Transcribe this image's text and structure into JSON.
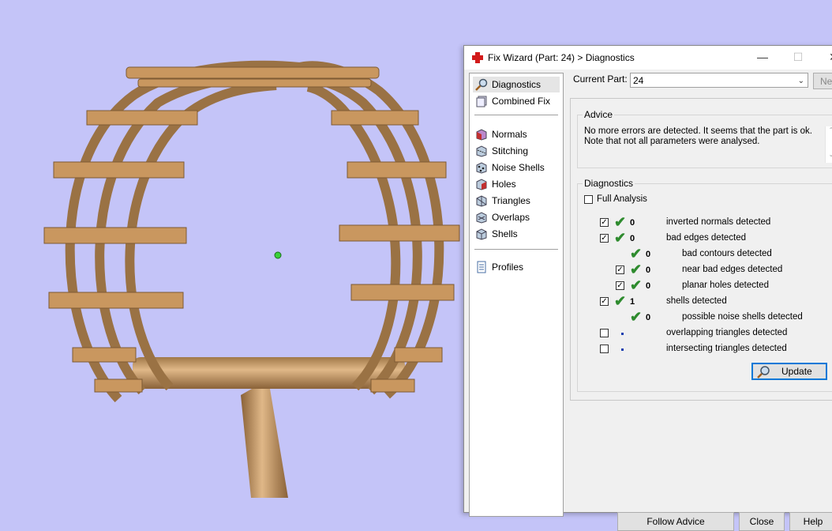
{
  "window": {
    "title": "Fix Wizard (Part: 24) > Diagnostics",
    "minimize": "—",
    "maximize": "☐",
    "close": "✕"
  },
  "sidebar": {
    "items": [
      {
        "label": "Diagnostics",
        "icon": "magnifier-icon"
      },
      {
        "label": "Combined Fix",
        "icon": "combined-fix-icon"
      },
      {
        "label": "Normals",
        "icon": "normals-icon"
      },
      {
        "label": "Stitching",
        "icon": "stitching-icon"
      },
      {
        "label": "Noise Shells",
        "icon": "noise-shells-icon"
      },
      {
        "label": "Holes",
        "icon": "holes-icon"
      },
      {
        "label": "Triangles",
        "icon": "triangles-icon"
      },
      {
        "label": "Overlaps",
        "icon": "overlaps-icon"
      },
      {
        "label": "Shells",
        "icon": "shells-icon"
      },
      {
        "label": "Profiles",
        "icon": "profiles-icon"
      }
    ]
  },
  "current_part": {
    "label": "Current Part:",
    "value": "24",
    "next_label": "Next"
  },
  "advice": {
    "title": "Advice",
    "line1": "No more errors are detected. It seems that the part is ok.",
    "line2": "Note that not all parameters were analysed."
  },
  "diagnostics": {
    "title": "Diagnostics",
    "full_analysis": "Full Analysis",
    "rows": [
      {
        "count": "0",
        "label": "inverted normals detected"
      },
      {
        "count": "0",
        "label": "bad edges detected"
      },
      {
        "count": "0",
        "label": "bad contours detected"
      },
      {
        "count": "0",
        "label": "near bad edges detected"
      },
      {
        "count": "0",
        "label": "planar holes detected"
      },
      {
        "count": "1",
        "label": "shells detected"
      },
      {
        "count": "0",
        "label": "possible noise shells detected"
      },
      {
        "count": "",
        "label": "overlapping triangles detected"
      },
      {
        "count": "",
        "label": "intersecting triangles detected"
      }
    ],
    "update_label": "Update"
  },
  "footer": {
    "follow_advice": "Follow Advice",
    "close": "Close",
    "help": "Help"
  },
  "colors": {
    "viewport_bg": "#c4c4f8",
    "model": "#b88a55",
    "ok_check": "#2e8b2e"
  }
}
